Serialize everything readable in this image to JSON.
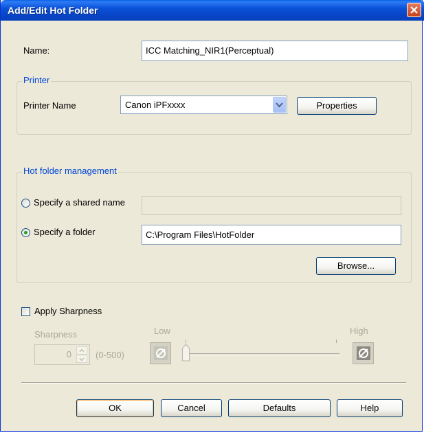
{
  "window": {
    "title": "Add/Edit Hot Folder"
  },
  "name_field": {
    "label": "Name:",
    "value": "ICC Matching_NIR1(Perceptual)"
  },
  "printer": {
    "group_title": "Printer",
    "printer_name_label": "Printer Name",
    "selected_printer": "Canon iPFxxxx",
    "properties_label": "Properties"
  },
  "hot_folder": {
    "group_title": "Hot folder management",
    "shared_name_label": "Specify a shared name",
    "shared_name_value": "",
    "shared_name_selected": false,
    "folder_label": "Specify a folder",
    "folder_value": "C:\\Program Files\\HotFolder",
    "folder_selected": true,
    "browse_label": "Browse..."
  },
  "sharpness": {
    "apply_label": "Apply Sharpness",
    "apply_checked": false,
    "sharpness_label": "Sharpness",
    "value": "0",
    "range_label": "(0-500)",
    "low_label": "Low",
    "high_label": "High",
    "slider_level": 0
  },
  "buttons": {
    "ok": "OK",
    "cancel": "Cancel",
    "defaults": "Defaults",
    "help": "Help"
  },
  "colors": {
    "titlebar": "#0a52d8",
    "group_title": "#0046d5",
    "dialog_bg": "#ece9d8"
  }
}
